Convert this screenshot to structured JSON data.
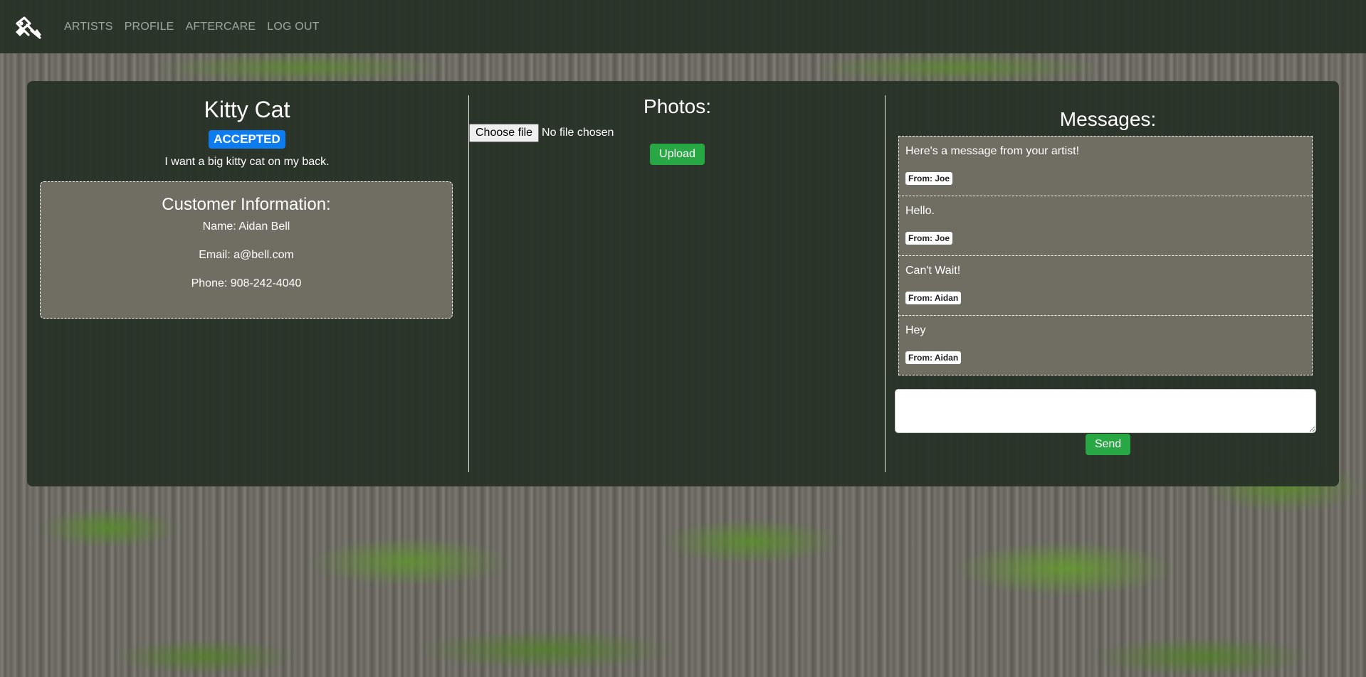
{
  "nav": {
    "logo_icon": "tattoo-machine-icon",
    "links": [
      "ARTISTS",
      "PROFILE",
      "AFTERCARE",
      "LOG OUT"
    ]
  },
  "request": {
    "title": "Kitty Cat",
    "status": "ACCEPTED",
    "description": "I want a big kitty cat on my back."
  },
  "customer": {
    "heading": "Customer Information:",
    "name": "Name: Aidan Bell",
    "email": "Email: a@bell.com",
    "phone": "Phone: 908-242-4040"
  },
  "photos": {
    "heading": "Photos:",
    "choose_file_label": "Choose file",
    "file_status": "No file chosen",
    "upload_label": "Upload"
  },
  "messages": {
    "heading": "Messages:",
    "items": [
      {
        "text": "Here's a message from your artist!",
        "from": "From: Joe"
      },
      {
        "text": "Hello.",
        "from": "From: Joe"
      },
      {
        "text": "Can't Wait!",
        "from": "From: Aidan"
      },
      {
        "text": "Hey",
        "from": "From: Aidan"
      }
    ],
    "input_value": "",
    "send_label": "Send"
  },
  "colors": {
    "status_badge": "#0d7cf0",
    "action_green": "#28a745",
    "panel": "#263026"
  }
}
